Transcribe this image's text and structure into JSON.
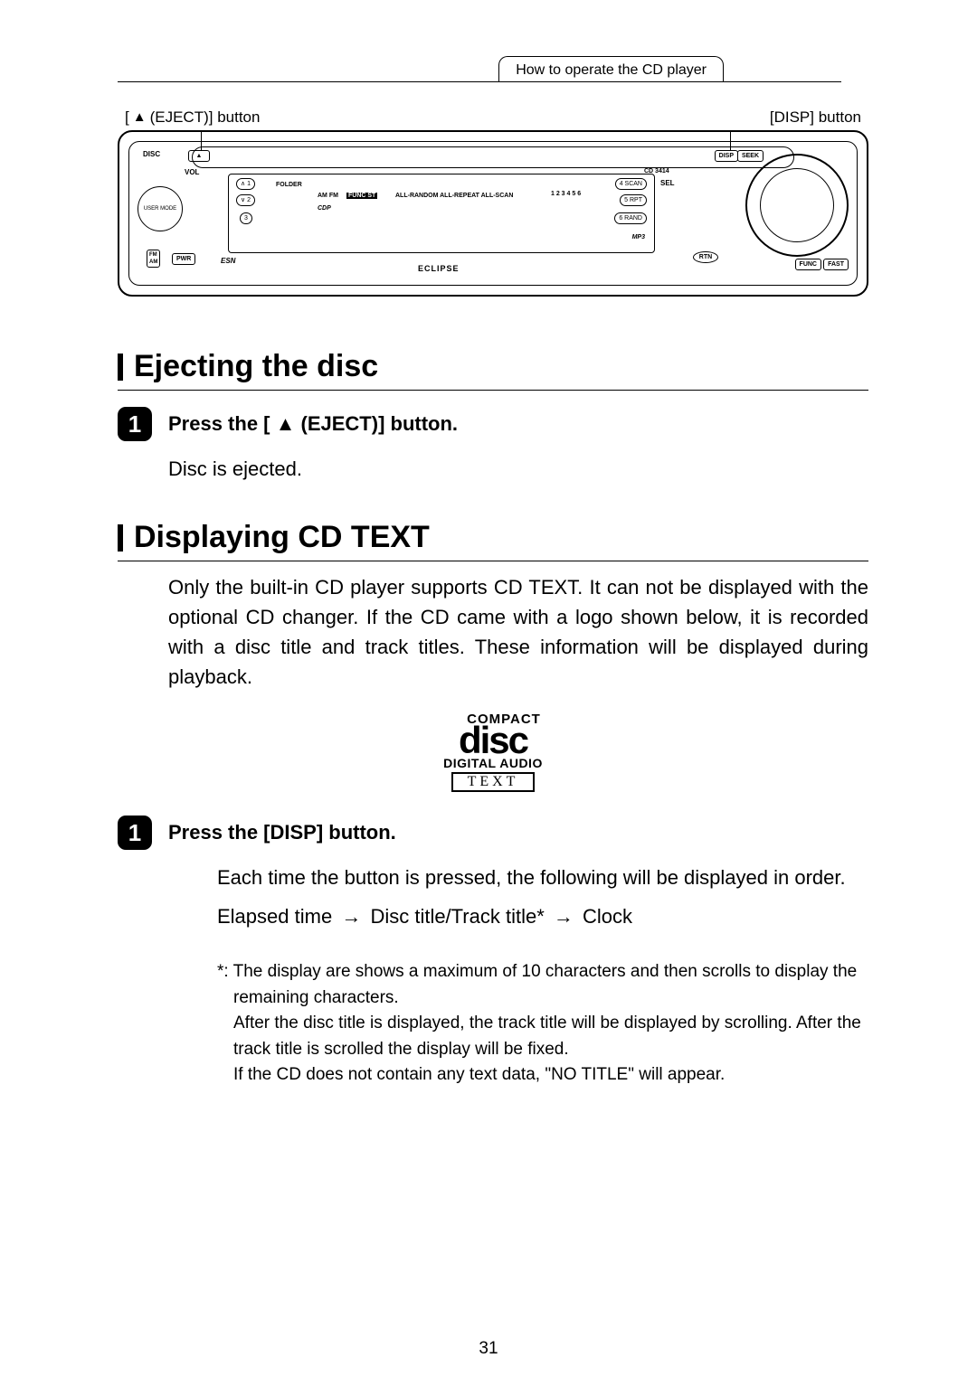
{
  "header": {
    "breadcrumb": "How to operate the CD player"
  },
  "diagram_labels": {
    "eject": "(EJECT)] button",
    "eject_prefix": "[ ",
    "disp": "[DISP] button"
  },
  "faceplate": {
    "usermode": "USER MODE",
    "disc": "DISC",
    "vol": "VOL",
    "folder": "FOLDER",
    "b1": "1",
    "b2": "2",
    "b3": "3",
    "esn": "ESN",
    "fm": "FM",
    "am": "AM",
    "pwr": "PWR",
    "model": "CD 3414",
    "sel": "SEL",
    "scan4": "4 SCAN",
    "rpt5": "5 RPT",
    "rand6": "6 RAND",
    "rtn": "RTN",
    "func": "FUNC",
    "fast": "FAST",
    "disp": "DISP",
    "seek": "SEEK",
    "brand": "ECLIPSE",
    "mp3": "MP3",
    "cdp": "CDP",
    "amfm": "AM FM",
    "funcst": "FUNC  ST",
    "modes": "ALL-RANDOM ALL-REPEAT ALL-SCAN",
    "preset": "1 2 3 4 5 6"
  },
  "section1": {
    "title": "Ejecting the disc",
    "step_num": "1",
    "step_title_prefix": "Press the [ ",
    "step_title_suffix": " (EJECT)] button.",
    "body": "Disc is ejected."
  },
  "section2": {
    "title": "Displaying CD TEXT",
    "intro": "Only the built-in CD player supports CD TEXT. It can not be displayed with the optional CD changer. If the CD came with a logo shown below, it is recorded with a disc title and track titles. These information will be displayed during playback.",
    "logo": {
      "compact": "COMPACT",
      "disc": "disc",
      "digital": "DIGITAL AUDIO",
      "text": "TEXT"
    },
    "step_num": "1",
    "step_title": "Press the [DISP] button.",
    "body1": "Each time the button is pressed, the following will be displayed in order.",
    "seq": {
      "a": "Elapsed time",
      "b": "Disc title/Track title*",
      "c": "Clock"
    },
    "note": {
      "l1": "*: The display are shows a maximum of 10 characters and then scrolls to display the remaining characters.",
      "l2": "After the disc title is displayed, the track title will be displayed by scrolling. After the track title is scrolled the display will be fixed.",
      "l3": "If the CD does not contain any text data, \"NO TITLE\" will appear."
    }
  },
  "page_number": "31"
}
